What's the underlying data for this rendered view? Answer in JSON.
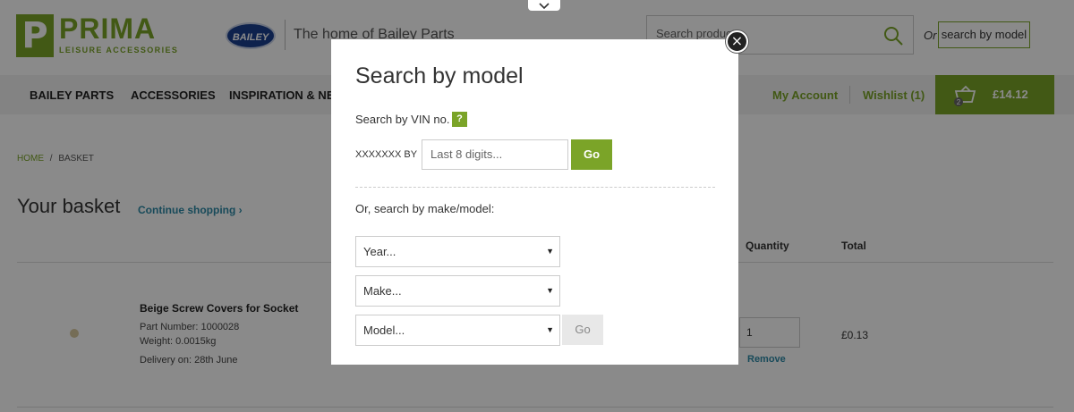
{
  "header": {
    "logo_mark": "P",
    "logo_main": "PRIMA",
    "logo_sub": "LEISURE ACCESSORIES",
    "bailey_badge": "BAILEY",
    "tagline": "The home of Bailey Parts",
    "search_placeholder": "Search products",
    "search_or": "Or",
    "search_model_link": "search by model"
  },
  "nav": {
    "items": [
      "BAILEY PARTS",
      "ACCESSORIES",
      "INSPIRATION & NEWS"
    ],
    "my_account": "My Account",
    "wishlist": "Wishlist (1)",
    "basket_count": "2",
    "basket_total": "£14.12"
  },
  "breadcrumb": {
    "home": "HOME",
    "sep": "/",
    "current": "BASKET"
  },
  "basket": {
    "title": "Your basket",
    "continue": "Continue shopping ›",
    "columns": {
      "quantity": "Quantity",
      "total": "Total"
    },
    "item": {
      "name": "Beige Screw Covers for Socket",
      "part_number": "Part Number: 1000028",
      "weight": "Weight: 0.0015kg",
      "delivery": "Delivery on: 28th June",
      "quantity": "1",
      "remove": "Remove",
      "total": "£0.13"
    }
  },
  "modal": {
    "title": "Search by model",
    "vin_label": "Search by VIN no.",
    "help": "?",
    "vin_prefix": "XXXXXXX BY",
    "vin_placeholder": "Last 8 digits...",
    "go": "Go",
    "make_model_label": "Or, search by make/model:",
    "year": "Year...",
    "make": "Make...",
    "model": "Model...",
    "go_disabled": "Go",
    "close": "×"
  },
  "colors": {
    "brand_green": "#7ba428",
    "link_blue": "#2d8aa6",
    "overlay": "rgba(0,0,0,0.46)"
  }
}
